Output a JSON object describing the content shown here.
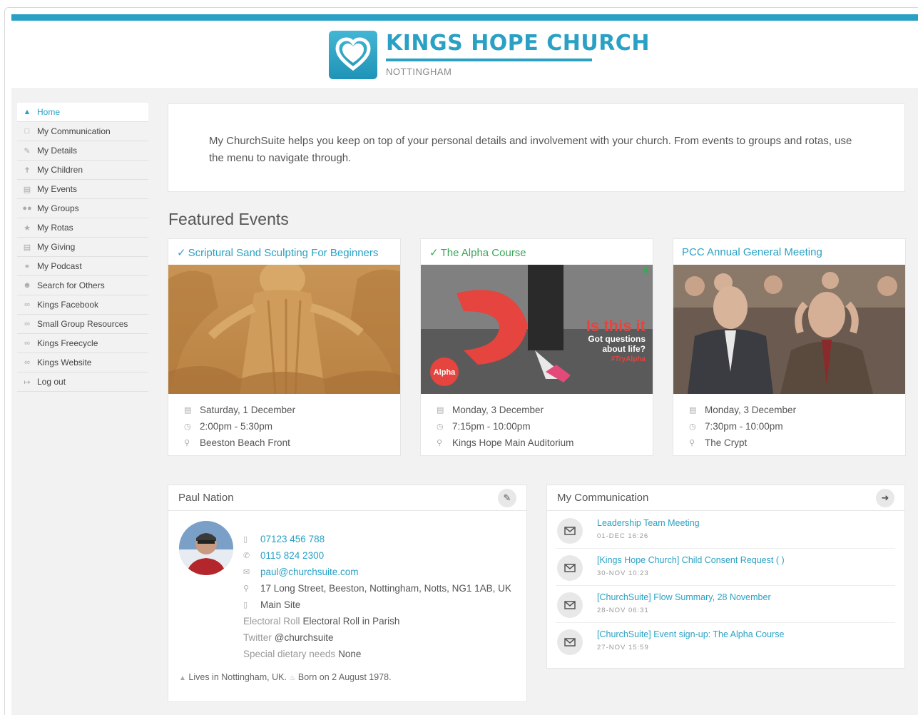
{
  "brand": {
    "name": "KINGS HOPE CHURCH",
    "location": "NOTTINGHAM",
    "accent": "#2aa1c4"
  },
  "sidebar": {
    "items": [
      {
        "label": "Home",
        "icon": "home-icon",
        "active": true
      },
      {
        "label": "My Communication",
        "icon": "chat-icon"
      },
      {
        "label": "My Details",
        "icon": "pencil-icon"
      },
      {
        "label": "My Children",
        "icon": "child-icon"
      },
      {
        "label": "My Events",
        "icon": "calendar-icon"
      },
      {
        "label": "My Groups",
        "icon": "group-icon"
      },
      {
        "label": "My Rotas",
        "icon": "star-icon"
      },
      {
        "label": "My Giving",
        "icon": "card-icon"
      },
      {
        "label": "My Podcast",
        "icon": "headphones-icon"
      },
      {
        "label": "Search for Others",
        "icon": "search-people-icon"
      },
      {
        "label": "Kings Facebook",
        "icon": "link-icon"
      },
      {
        "label": "Small Group Resources",
        "icon": "link-icon"
      },
      {
        "label": "Kings Freecycle",
        "icon": "link-icon"
      },
      {
        "label": "Kings Website",
        "icon": "link-icon"
      },
      {
        "label": "Log out",
        "icon": "logout-icon"
      }
    ]
  },
  "intro": {
    "text": "My ChurchSuite helps you keep on top of your personal details and involvement with your church. From events to groups and rotas, use the menu to navigate through."
  },
  "featured": {
    "heading": "Featured Events",
    "events": [
      {
        "title": "Scriptural Sand Sculpting For Beginners",
        "checked": true,
        "date": "Saturday, 1 December",
        "time": "2:00pm - 5:30pm",
        "location": "Beeston Beach Front"
      },
      {
        "title": "The Alpha Course",
        "checked": true,
        "date": "Monday, 3 December",
        "time": "7:15pm - 10:00pm",
        "location": "Kings Hope Main Auditorium",
        "image_text": {
          "headline": "Is this it",
          "line1": "Got questions",
          "line2": "about life?",
          "tag": "#TryAlpha",
          "badge": "Alpha"
        }
      },
      {
        "title": "PCC Annual General Meeting",
        "checked": false,
        "date": "Monday, 3 December",
        "time": "7:30pm - 10:00pm",
        "location": "The Crypt"
      }
    ]
  },
  "profile": {
    "name": "Paul Nation",
    "mobile": "07123 456 788",
    "phone": "0115 824 2300",
    "email": "paul@churchsuite.com",
    "address": "17 Long Street, Beeston, Nottingham, Notts, NG1 1AB, UK",
    "site": "Main Site",
    "fields": [
      {
        "label": "Electoral Roll",
        "value": "Electoral Roll in Parish"
      },
      {
        "label": "Twitter",
        "value": "@churchsuite"
      },
      {
        "label": "Special dietary needs",
        "value": "None"
      }
    ],
    "lives": "Lives in Nottingham, UK.",
    "born": "Born on 2 August 1978."
  },
  "communication": {
    "heading": "My Communication",
    "items": [
      {
        "title": "Leadership Team Meeting",
        "date": "01-DEC 16:26"
      },
      {
        "title": "[Kings Hope Church] Child Consent Request ( )",
        "date": "30-NOV 10:23"
      },
      {
        "title": "[ChurchSuite] Flow Summary, 28 November",
        "date": "28-NOV 06:31"
      },
      {
        "title": "[ChurchSuite] Event sign-up: The Alpha Course",
        "date": "27-NOV 15:59"
      }
    ]
  }
}
